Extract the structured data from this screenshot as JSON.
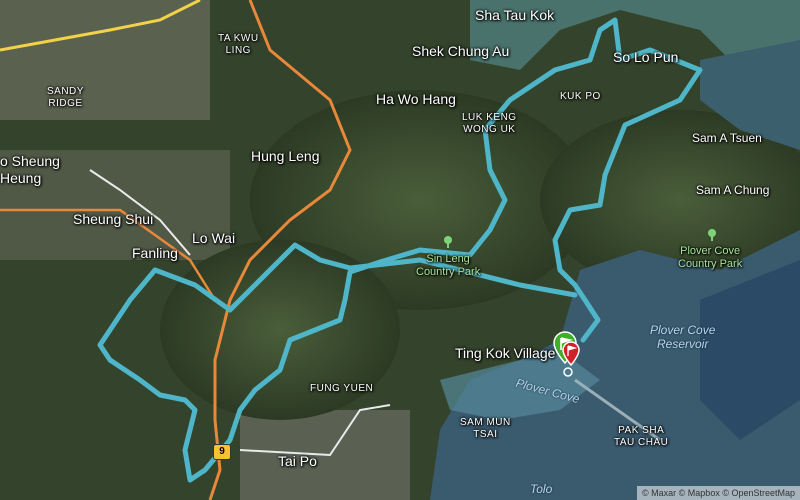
{
  "labels": {
    "sha_tau_kok": "Sha Tau Kok",
    "ta_kwu_ling": "TA KWU\nLING",
    "shek_chung_au": "Shek Chung Au",
    "so_lo_pun": "So Lo Pun",
    "ha_wo_hang": "Ha Wo Hang",
    "kuk_po": "KUK PO",
    "luk_keng": "LUK KENG\nWONG UK",
    "sandy_ridge": "SANDY\nRIDGE",
    "hung_leng": "Hung Leng",
    "sam_a_tsuen": "Sam A Tsuen",
    "sam_a_chung": "Sam A Chung",
    "ho_sheung_heung": "o Sheung\nHeung",
    "sheung_shui": "Sheung Shui",
    "lo_wai": "Lo Wai",
    "fanling": "Fanling",
    "sin_leng": "Sin Leng\nCountry Park",
    "plover_cove_cp": "Plover Cove\nCountry Park",
    "plover_cove_reservoir": "Plover Cove\nReservoir",
    "ting_kok": "Ting Kok Village",
    "fung_yuen": "FUNG YUEN",
    "plover_cove": "Plover Cove",
    "sam_mun_tsai": "SAM MUN\nTSAI",
    "pak_sha_tau_chau": "PAK SHA\nTAU CHAU",
    "tai_po": "Tai Po",
    "tolo": "Tolo"
  },
  "route_shield": "9",
  "attribution": "© Maxar © Mapbox © OpenStreetMap",
  "colors": {
    "route": "#4fb6c9",
    "highway": "#e8883a",
    "water": "#3a5a6e",
    "start_pin": "#3fae2a",
    "end_pin": "#d0202a"
  }
}
